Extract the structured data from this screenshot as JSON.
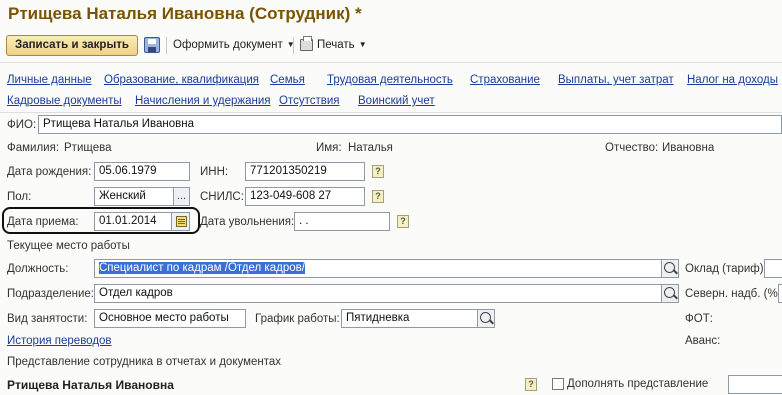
{
  "window": {
    "title": "Ртищева Наталья Ивановна (Сотрудник) *"
  },
  "toolbar": {
    "save_close_label": "Записать и закрыть",
    "create_doc_label": "Оформить документ",
    "print_label": "Печать"
  },
  "nav": {
    "row1": [
      "Личные данные",
      "Образование, квалификация",
      "Семья",
      "Трудовая деятельность",
      "Страхование",
      "Выплаты, учет затрат",
      "Налог на доходы"
    ],
    "row2": [
      "Кадровые документы",
      "Начисления и удержания",
      "Отсутствия",
      "Воинский учет"
    ]
  },
  "form": {
    "fio_label": "ФИО:",
    "fio_value": "Ртищева Наталья Ивановна",
    "surname_label": "Фамилия:",
    "surname_value": "Ртищева",
    "name_label": "Имя:",
    "name_value": "Наталья",
    "patronymic_label": "Отчество:",
    "patronymic_value": "Ивановна",
    "birth_label": "Дата рождения:",
    "birth_value": "05.06.1979",
    "inn_label": "ИНН:",
    "inn_value": "771201350219",
    "gender_label": "Пол:",
    "gender_value": "Женский",
    "snils_label": "СНИЛС:",
    "snils_value": "123-049-608 27",
    "hire_label": "Дата приема:",
    "hire_value": "01.01.2014",
    "dismiss_label": "Дата увольнения:",
    "dismiss_value": " .  .",
    "help_mark": "?",
    "ellipsis": "..."
  },
  "work": {
    "section_label": "Текущее место работы",
    "position_label": "Должность:",
    "position_value": "Специалист по кадрам /Отдел кадров/",
    "department_label": "Подразделение:",
    "department_value": "Отдел кадров",
    "employment_label": "Вид занятости:",
    "employment_value": "Основное место работы",
    "schedule_label": "График работы:",
    "schedule_value": "Пятидневка",
    "history_link": "История переводов",
    "salary_label": "Оклад (тариф):",
    "north_label": "Северн. надб. (%):",
    "fot_label": "ФОТ:",
    "advance_label": "Аванс:"
  },
  "presentation": {
    "section_label": "Представление сотрудника в отчетах и документах",
    "name_value": "Ртищева Наталья Ивановна",
    "extend_label": "Дополнять представление"
  }
}
